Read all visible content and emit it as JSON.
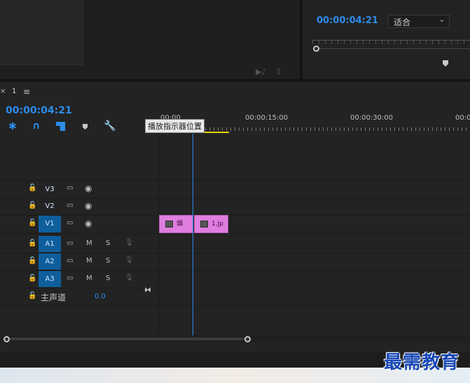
{
  "program_monitor": {
    "timecode": "00:00:04:21",
    "fit_select": "适合"
  },
  "timeline": {
    "tab_label": "1",
    "close_glyph": "×",
    "menu_glyph": "≡",
    "timecode": "00:00:04:21",
    "ruler_labels": [
      "00:00",
      "00:00:15:00",
      "00:00:30:00",
      "00:0"
    ],
    "tooltip": "播放指示器位置",
    "tracks": [
      {
        "id": "V3",
        "type": "video",
        "targeted": false
      },
      {
        "id": "V2",
        "type": "video",
        "targeted": false
      },
      {
        "id": "V1",
        "type": "video",
        "targeted": true
      },
      {
        "id": "A1",
        "type": "audio",
        "targeted": true,
        "m": "M",
        "s": "S"
      },
      {
        "id": "A2",
        "type": "audio",
        "targeted": true,
        "m": "M",
        "s": "S"
      },
      {
        "id": "A3",
        "type": "audio",
        "targeted": true,
        "m": "M",
        "s": "S"
      }
    ],
    "master": {
      "label": "主声道",
      "value": "0.0"
    },
    "clips": [
      {
        "label": "烟"
      },
      {
        "label": "1.jp"
      }
    ]
  },
  "watermark": "最需教育",
  "colors": {
    "accent": "#2d8ceb",
    "clip": "#e07ee0",
    "playhead": "#2d8ceb",
    "work_area": "#e8d000"
  }
}
